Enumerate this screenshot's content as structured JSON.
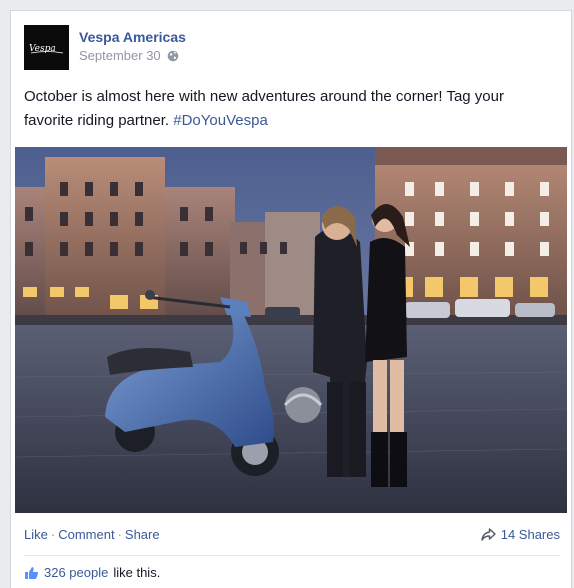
{
  "post": {
    "page_name": "Vespa Americas",
    "date": "September 30",
    "logo_text": "Vespa",
    "text": "October is almost here with new adventures around the corner! Tag your favorite riding partner. ",
    "hashtag": "#DoYouVespa"
  },
  "actions": {
    "like": "Like",
    "comment": "Comment",
    "share": "Share",
    "separator": "·",
    "shares": "14 Shares"
  },
  "likes": {
    "count": "326 people",
    "suffix": "like this."
  },
  "colors": {
    "link": "#3b5998",
    "meta": "#9197a3",
    "text": "#141823"
  },
  "icons": {
    "privacy": "globe-icon",
    "share": "share-arrow-icon",
    "like": "thumbs-up-icon"
  }
}
